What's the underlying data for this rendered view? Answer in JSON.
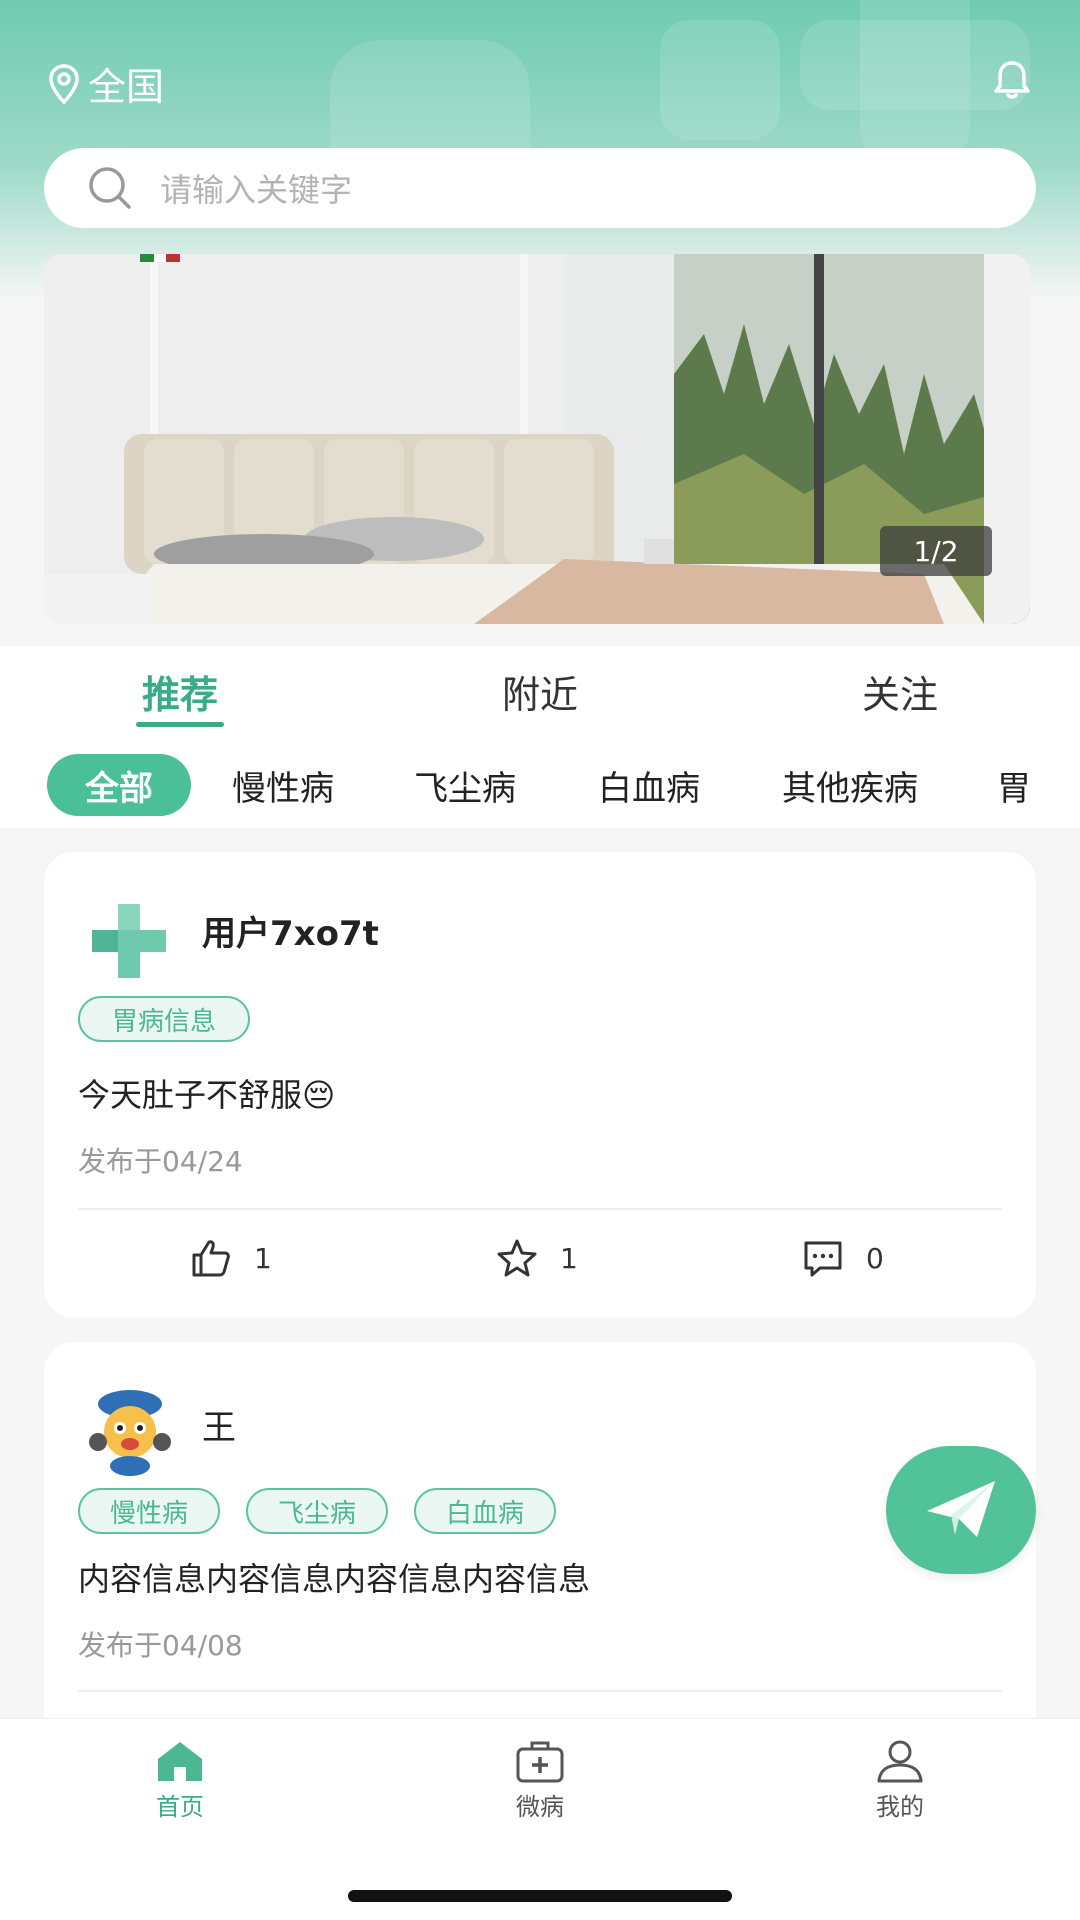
{
  "header": {
    "location": "全国",
    "search_placeholder": "请输入关键字"
  },
  "banner": {
    "counter": "1/2"
  },
  "tabs": [
    {
      "label": "推荐",
      "active": true
    },
    {
      "label": "附近",
      "active": false
    },
    {
      "label": "关注",
      "active": false
    }
  ],
  "categories": [
    {
      "label": "全部",
      "active": true
    },
    {
      "label": "慢性病",
      "active": false
    },
    {
      "label": "飞尘病",
      "active": false
    },
    {
      "label": "白血病",
      "active": false
    },
    {
      "label": "其他疾病",
      "active": false
    },
    {
      "label": "胃",
      "active": false
    }
  ],
  "posts": [
    {
      "author": "用户7xo7t",
      "avatar_icon": "medical-cross-icon",
      "tags": [
        "胃病信息"
      ],
      "content": "今天肚子不舒服😔",
      "date": "发布于04/24",
      "likes": "1",
      "favorites": "1",
      "comments": "0"
    },
    {
      "author": "王",
      "avatar_icon": "cartoon-avatar-icon",
      "tags": [
        "慢性病",
        "飞尘病",
        "白血病"
      ],
      "content": "内容信息内容信息内容信息内容信息",
      "date": "发布于04/08"
    }
  ],
  "bottom_nav": [
    {
      "label": "首页",
      "icon": "home-icon",
      "active": true
    },
    {
      "label": "微病",
      "icon": "medical-kit-icon",
      "active": false
    },
    {
      "label": "我的",
      "icon": "user-icon",
      "active": false
    }
  ],
  "colors": {
    "accent": "#3aaa87",
    "header_gradient_top": "#6fcbb0",
    "tag_border": "#5cc3a2"
  }
}
